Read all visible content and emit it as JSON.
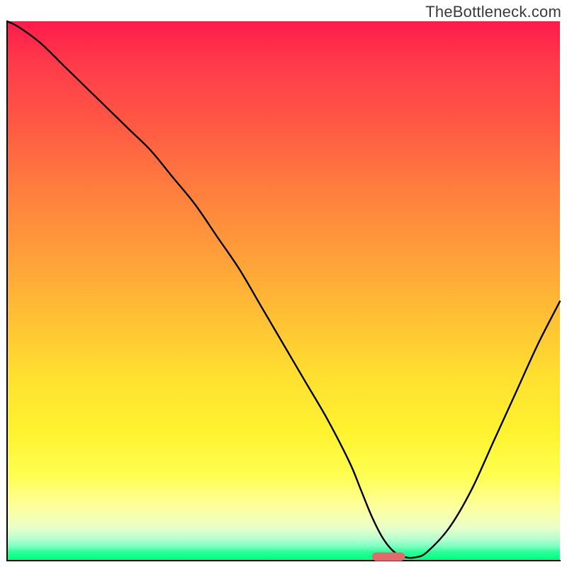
{
  "watermark": "TheBottleneck.com",
  "chart_data": {
    "type": "line",
    "title": "",
    "xlabel": "",
    "ylabel": "",
    "xlim": [
      0,
      100
    ],
    "ylim": [
      0,
      100
    ],
    "x": [
      0,
      2,
      6,
      10,
      14,
      18,
      22,
      26,
      30,
      34,
      38,
      42,
      46,
      50,
      54,
      58,
      62,
      64,
      66,
      68,
      70,
      72,
      74,
      76,
      80,
      84,
      88,
      92,
      96,
      100
    ],
    "values": [
      100,
      99,
      96,
      92,
      88,
      84,
      80,
      76,
      71,
      66,
      60,
      54,
      47,
      40,
      33,
      26,
      18,
      13,
      8,
      4,
      1.5,
      0.5,
      0.5,
      1.5,
      6,
      13,
      22,
      31,
      40,
      48
    ],
    "marker": {
      "x_start": 66,
      "x_end": 72,
      "y": 0.6
    },
    "background_gradient": {
      "top": "#ff1a4b",
      "mid": "#ffe030",
      "bottom": "#00ff7b"
    }
  }
}
